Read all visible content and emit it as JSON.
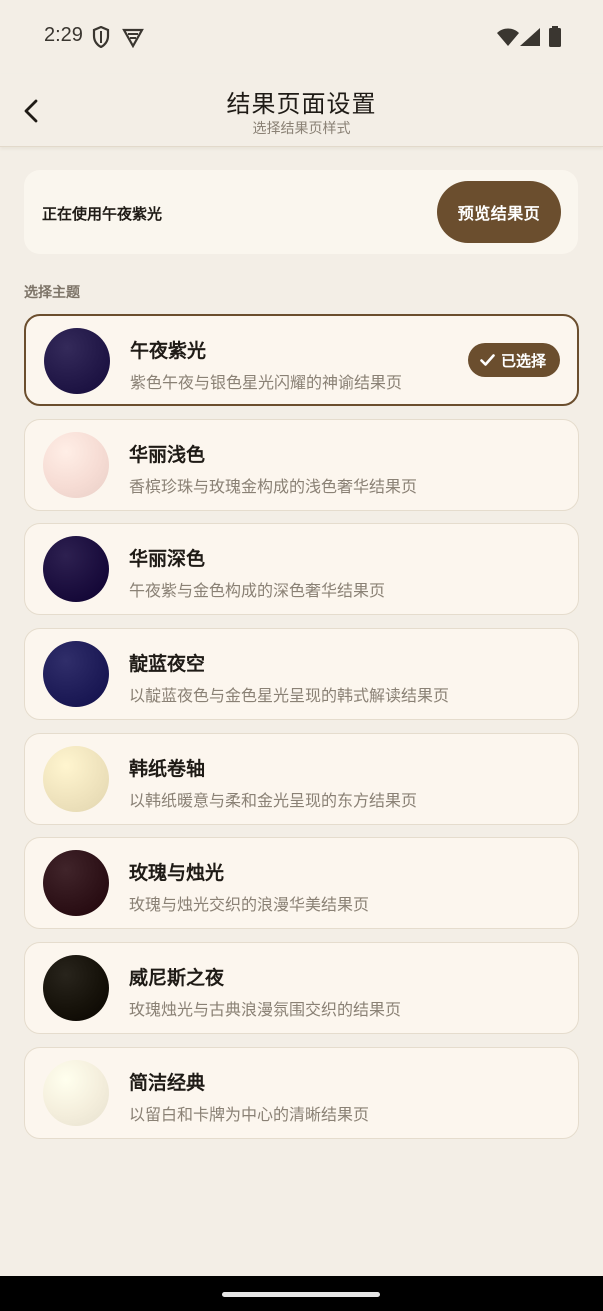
{
  "status_bar": {
    "time": "2:29",
    "left_icons": [
      "shield-icon",
      "vpn-icon"
    ],
    "right_icons": [
      "wifi-icon",
      "cellular-icon",
      "battery-icon"
    ]
  },
  "header": {
    "title": "结果页面设置",
    "subtitle": "选择结果页样式",
    "back_icon": "chevron-left-icon"
  },
  "current": {
    "text": "正在使用午夜紫光",
    "preview_button": "预览结果页"
  },
  "section_label": "选择主题",
  "selected_badge": "已选择",
  "colors": {
    "accent": "#6b4e2e",
    "background": "#f3eee6",
    "card": "#fcf6ee"
  },
  "themes": [
    {
      "name": "午夜紫光",
      "desc": "紫色午夜与银色星光闪耀的神谕结果页",
      "selected": true,
      "swatch": "#221848"
    },
    {
      "name": "华丽浅色",
      "desc": "香槟珍珠与玫瑰金构成的浅色奢华结果页",
      "selected": false,
      "swatch": "#f6dcd4"
    },
    {
      "name": "华丽深色",
      "desc": "午夜紫与金色构成的深色奢华结果页",
      "selected": false,
      "swatch": "#1b0e3e"
    },
    {
      "name": "靛蓝夜空",
      "desc": "以靛蓝夜色与金色星光呈现的韩式解读结果页",
      "selected": false,
      "swatch": "#1e1c58"
    },
    {
      "name": "韩纸卷轴",
      "desc": "以韩纸暖意与柔和金光呈现的东方结果页",
      "selected": false,
      "swatch": "#efe3bd"
    },
    {
      "name": "玫瑰与烛光",
      "desc": "玫瑰与烛光交织的浪漫华美结果页",
      "selected": false,
      "swatch": "#2e1218"
    },
    {
      "name": "威尼斯之夜",
      "desc": "玫瑰烛光与古典浪漫氛围交织的结果页",
      "selected": false,
      "swatch": "#16120a"
    },
    {
      "name": "简洁经典",
      "desc": "以留白和卡牌为中心的清晰结果页",
      "selected": false,
      "swatch": "#f4eedc"
    }
  ]
}
